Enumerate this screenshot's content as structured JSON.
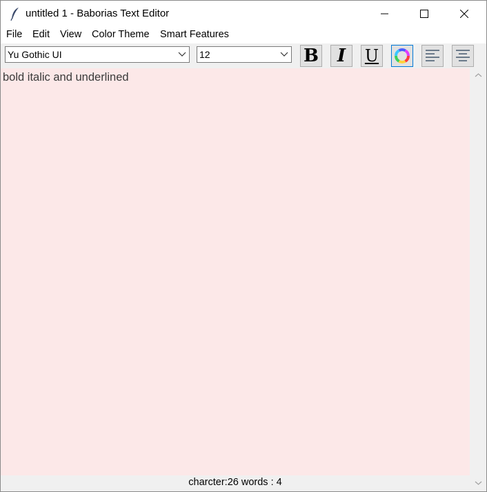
{
  "window": {
    "title": "untitled 1 - Baborias Text Editor"
  },
  "menubar": {
    "items": [
      {
        "label": "File"
      },
      {
        "label": "Edit"
      },
      {
        "label": "View"
      },
      {
        "label": "Color Theme"
      },
      {
        "label": "Smart Features"
      }
    ]
  },
  "toolbar": {
    "font_family": "Yu Gothic UI",
    "font_size": "12",
    "icons": [
      "bold-icon",
      "italic-icon",
      "underline-icon",
      "color-wheel-icon",
      "align-left-icon",
      "align-center-icon"
    ]
  },
  "editor": {
    "text": "bold italic and underlined",
    "background": "#fce8e8"
  },
  "status": {
    "text": "charcter:26 words : 4"
  }
}
